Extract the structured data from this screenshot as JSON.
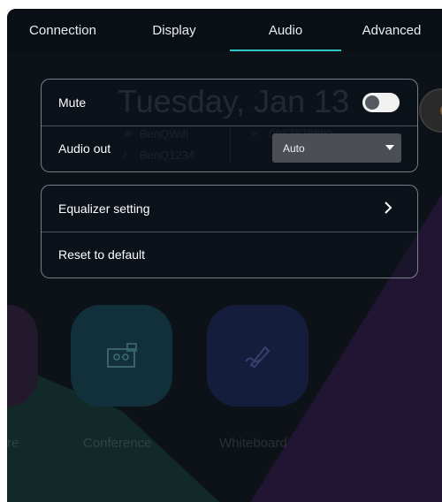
{
  "tabs": [
    {
      "label": "Connection",
      "active": false
    },
    {
      "label": "Display",
      "active": false
    },
    {
      "label": "Audio",
      "active": true
    },
    {
      "label": "Advanced",
      "active": false
    }
  ],
  "accent_color": "#2fc6c6",
  "audio": {
    "mute": {
      "label": "Mute",
      "enabled": false
    },
    "audio_out": {
      "label": "Audio out",
      "selected": "Auto",
      "caret_icon": "caret-down-icon"
    }
  },
  "sound": {
    "equalizer": {
      "label": "Equalizer setting",
      "icon": "chevron-right-icon"
    },
    "reset": {
      "label": "Reset to default"
    }
  },
  "background": {
    "date": "Tuesday, Jan 13",
    "wifi_name": "BenQWifi",
    "device_name": "BenQ1234",
    "phone": "0987878800",
    "apps": [
      {
        "label": "re",
        "icon": "app-icon"
      },
      {
        "label": "Conference",
        "icon": "conference-icon"
      },
      {
        "label": "Whiteboard",
        "icon": "whiteboard-pen-icon"
      }
    ]
  }
}
